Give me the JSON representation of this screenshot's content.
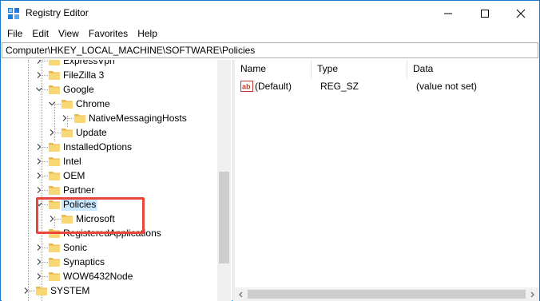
{
  "window": {
    "title": "Registry Editor"
  },
  "menu": [
    "File",
    "Edit",
    "View",
    "Favorites",
    "Help"
  ],
  "address": "Computer\\HKEY_LOCAL_MACHINE\\SOFTWARE\\Policies",
  "tree": [
    {
      "label": "ExpressVpn",
      "chevron": "right"
    },
    {
      "label": "FileZilla 3",
      "chevron": "right"
    },
    {
      "label": "Google",
      "chevron": "down"
    },
    {
      "label": "Chrome",
      "chevron": "down"
    },
    {
      "label": "NativeMessagingHosts",
      "chevron": "right"
    },
    {
      "label": "Update",
      "chevron": "right"
    },
    {
      "label": "InstalledOptions",
      "chevron": "right"
    },
    {
      "label": "Intel",
      "chevron": "right"
    },
    {
      "label": "OEM",
      "chevron": "right"
    },
    {
      "label": "Partner",
      "chevron": "right"
    },
    {
      "label": "Policies",
      "chevron": "down",
      "selected": true
    },
    {
      "label": "Microsoft",
      "chevron": "right"
    },
    {
      "label": "RegisteredApplications",
      "chevron": "none"
    },
    {
      "label": "Sonic",
      "chevron": "right"
    },
    {
      "label": "Synaptics",
      "chevron": "right"
    },
    {
      "label": "WOW6432Node",
      "chevron": "right"
    },
    {
      "label": "SYSTEM",
      "chevron": "right"
    }
  ],
  "values": {
    "headers": {
      "name": "Name",
      "type": "Type",
      "data": "Data"
    },
    "rows": [
      {
        "name": "(Default)",
        "type": "REG_SZ",
        "data": "(value not set)"
      }
    ]
  },
  "colors": {
    "highlight": "#e8473a",
    "selection": "#cce8ff",
    "folder": "#f8d775"
  }
}
